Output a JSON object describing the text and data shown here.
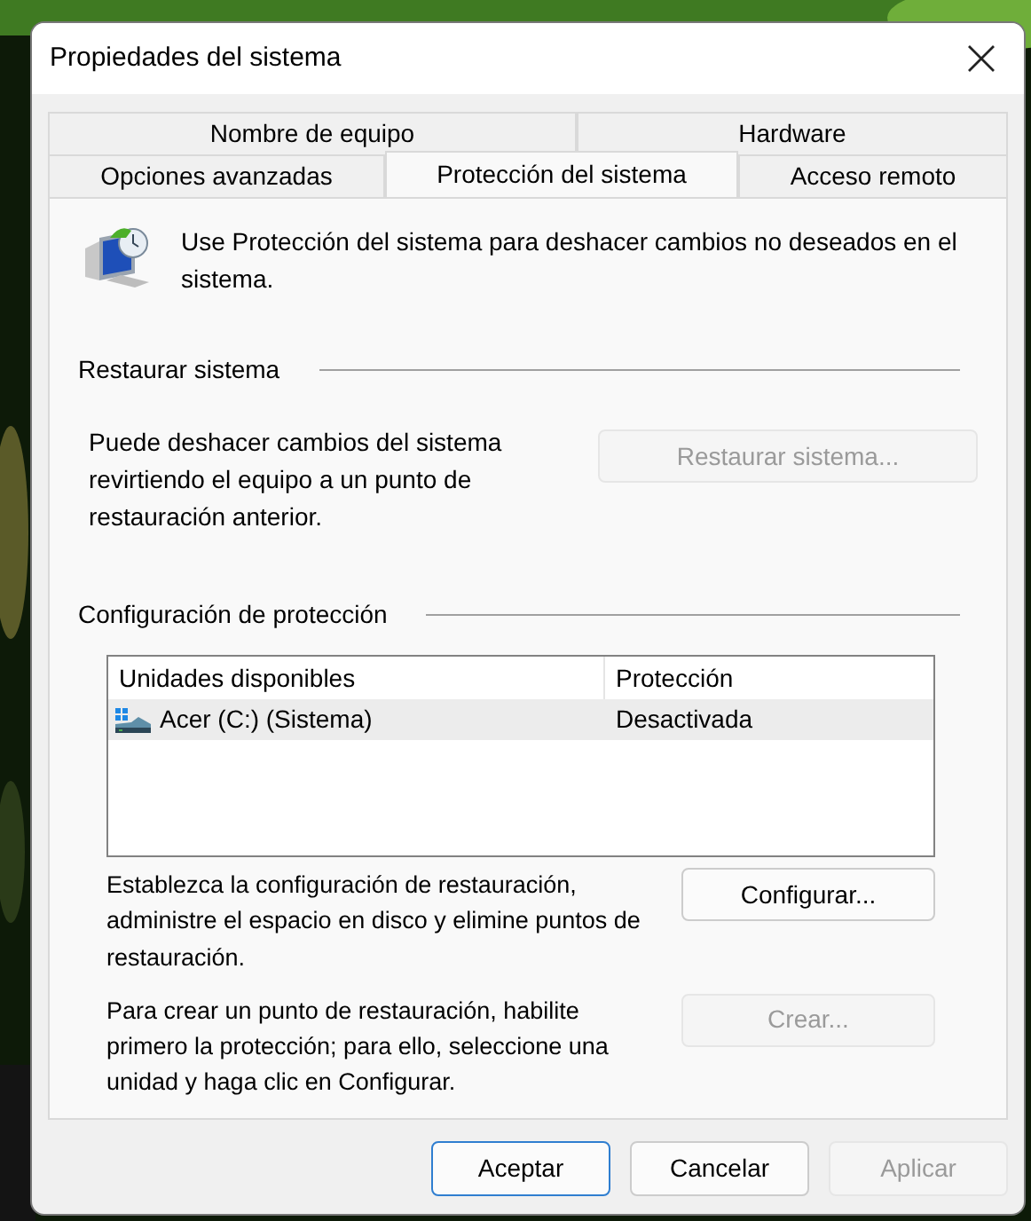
{
  "window": {
    "title": "Propiedades del sistema"
  },
  "tabs": [
    [
      {
        "label": "Nombre de equipo",
        "selected": false
      },
      {
        "label": "Hardware",
        "selected": false
      }
    ],
    [
      {
        "label": "Opciones avanzadas",
        "selected": false
      },
      {
        "label": "Protección del sistema",
        "selected": true
      },
      {
        "label": "Acceso remoto",
        "selected": false
      }
    ]
  ],
  "intro": "Use Protección del sistema para deshacer cambios no deseados en el sistema.",
  "restore": {
    "heading": "Restaurar sistema",
    "text": "Puede deshacer cambios del sistema revirtiendo el equipo a un punto de restauración anterior.",
    "button": {
      "label": "Restaurar sistema...",
      "disabled": true
    }
  },
  "protection": {
    "heading": "Configuración de protección",
    "table": {
      "columns": [
        "Unidades disponibles",
        "Protección"
      ],
      "rows": [
        {
          "drive": "Acer (C:) (Sistema)",
          "protection": "Desactivada",
          "selected": true
        }
      ]
    },
    "actions": [
      {
        "text": "Establezca la configuración de restauración, administre el espacio en disco y elimine puntos de restauración.",
        "button": {
          "label": "Configurar...",
          "disabled": false
        }
      },
      {
        "text": "Para crear un punto de restauración, habilite primero la protección; para ello, seleccione una unidad y haga clic en Configurar.",
        "button": {
          "label": "Crear...",
          "disabled": true
        }
      }
    ]
  },
  "buttons": [
    {
      "label": "Aceptar",
      "kind": "default",
      "disabled": false
    },
    {
      "label": "Cancelar",
      "kind": "normal",
      "disabled": false
    },
    {
      "label": "Aplicar",
      "kind": "normal",
      "disabled": true
    }
  ]
}
